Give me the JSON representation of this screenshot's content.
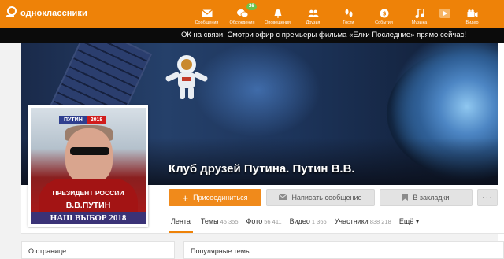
{
  "header": {
    "logo_text": "одноклассники",
    "accent": "#ee8208",
    "nav": [
      {
        "label": "Сообщения",
        "icon": "envelope-icon"
      },
      {
        "label": "Обсуждения",
        "icon": "chat-bubbles-icon",
        "badge": "26"
      },
      {
        "label": "Оповещения",
        "icon": "bell-icon"
      },
      {
        "label": "Друзья",
        "icon": "friends-icon"
      },
      {
        "label": "Гости",
        "icon": "footprints-icon"
      },
      {
        "label": "События",
        "icon": "events-icon"
      },
      {
        "label": "Музыка",
        "icon": "music-note-icon"
      },
      {
        "label": "Видео",
        "icon": "video-camera-icon"
      }
    ]
  },
  "ticker": {
    "text": "ОК на связи! Смотри эфир с премьеры фильма «Елки Последние» прямо сейчас!"
  },
  "group": {
    "title": "Клуб друзей Путина. Путин В.В."
  },
  "avatar": {
    "tag_left": "ПУТИН",
    "tag_right": "2018",
    "line1": "ПРЕЗИДЕНТ РОССИИ",
    "line2": "В.В.ПУТИН",
    "line3": "НАШ ВЫБОР 2018"
  },
  "actions": {
    "join": "Присоединиться",
    "message": "Написать сообщение",
    "bookmark": "В закладки",
    "more": "···"
  },
  "tabs": [
    {
      "label": "Лента",
      "count": ""
    },
    {
      "label": "Темы",
      "count": "45 355"
    },
    {
      "label": "Фото",
      "count": "56 411"
    },
    {
      "label": "Видео",
      "count": "1 366"
    },
    {
      "label": "Участники",
      "count": "838 218"
    },
    {
      "label": "Ещё ▾",
      "count": ""
    }
  ],
  "panels": {
    "left_title": "О странице",
    "right_title": "Популярные темы"
  }
}
